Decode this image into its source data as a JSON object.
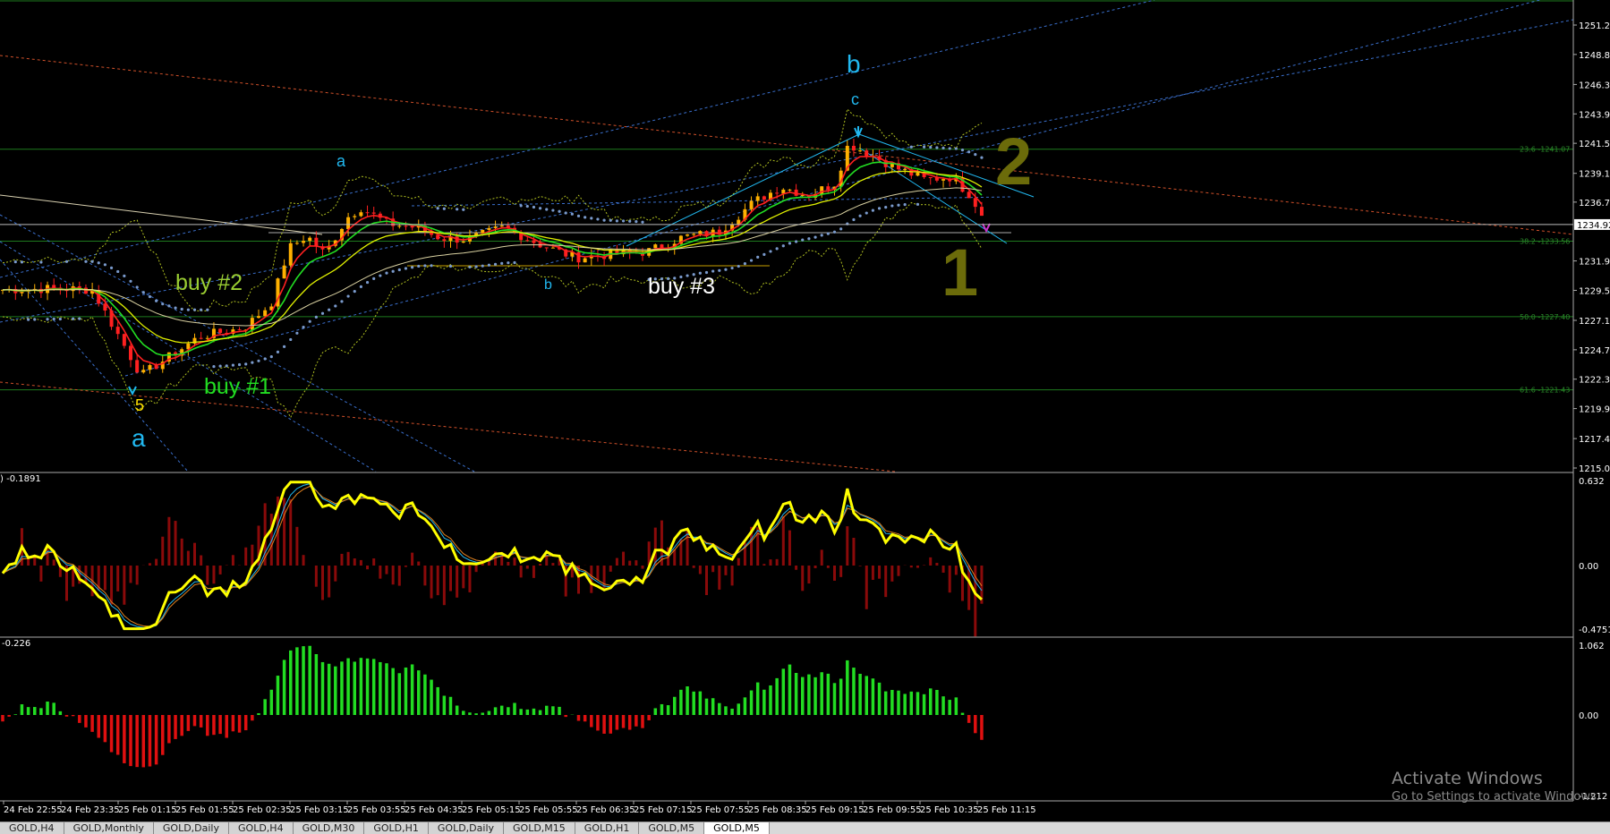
{
  "main_chart": {
    "price_axis": [
      "1251.20",
      "1248.80",
      "1246.35",
      "1243.95",
      "1241.55",
      "1239.10",
      "1236.75",
      "1234.92",
      "1231.95",
      "1229.55",
      "1227.10",
      "1224.70",
      "1222.30",
      "1219.90",
      "1217.45",
      "1215.05"
    ],
    "current_price": "1234.92",
    "fib_labels": [
      "23.6 -1241.07",
      "38.2 -1233.56",
      "50.0 -1227.40",
      "61.6 -1221.43"
    ],
    "annotations": {
      "wave_b_top": "b",
      "wave_c": "c",
      "wave_a_mid": "a",
      "wave_b_low": "b",
      "wave_5": "5",
      "wave_a_bottom": "a",
      "buy1": "buy #1",
      "buy2": "buy #2",
      "buy3": "buy #3",
      "big1": "1",
      "big2": "2"
    }
  },
  "oscillator1": {
    "label": ") -0.1891",
    "axis": [
      "0.632",
      "0.00",
      "-0.4751"
    ]
  },
  "oscillator2": {
    "label": "-0.226",
    "axis": [
      "1.062",
      "0.00",
      "-1.212"
    ]
  },
  "time_axis": [
    "24 Feb 22:55",
    "24 Feb 23:35",
    "25 Feb 01:15",
    "25 Feb 01:55",
    "25 Feb 02:35",
    "25 Feb 03:15",
    "25 Feb 03:55",
    "25 Feb 04:35",
    "25 Feb 05:15",
    "25 Feb 05:55",
    "25 Feb 06:35",
    "25 Feb 07:15",
    "25 Feb 07:55",
    "25 Feb 08:35",
    "25 Feb 09:15",
    "25 Feb 09:55",
    "25 Feb 10:35",
    "25 Feb 11:15"
  ],
  "tabs": [
    "GOLD,H4",
    "GOLD,Monthly",
    "GOLD,Daily",
    "GOLD,H4",
    "GOLD,M30",
    "GOLD,H1",
    "GOLD,Daily",
    "GOLD,M15",
    "GOLD,H1",
    "GOLD,M5",
    "GOLD,M5"
  ],
  "active_tab_index": 10,
  "watermark": {
    "line1": "Activate Windows",
    "line2": "Go to Settings to activate Windows."
  },
  "colors": {
    "bull_candle": "#ffb000",
    "bear_candle": "#ff2020",
    "ma_red": "#ff2020",
    "ma_green": "#22dd22",
    "ma_yellow": "#e0f000",
    "cyan": "#21b8f0",
    "fib": "#1e7a1e",
    "osc_main": "#ffff00",
    "hist_green": "#22dd22",
    "hist_red": "#e01010"
  }
}
